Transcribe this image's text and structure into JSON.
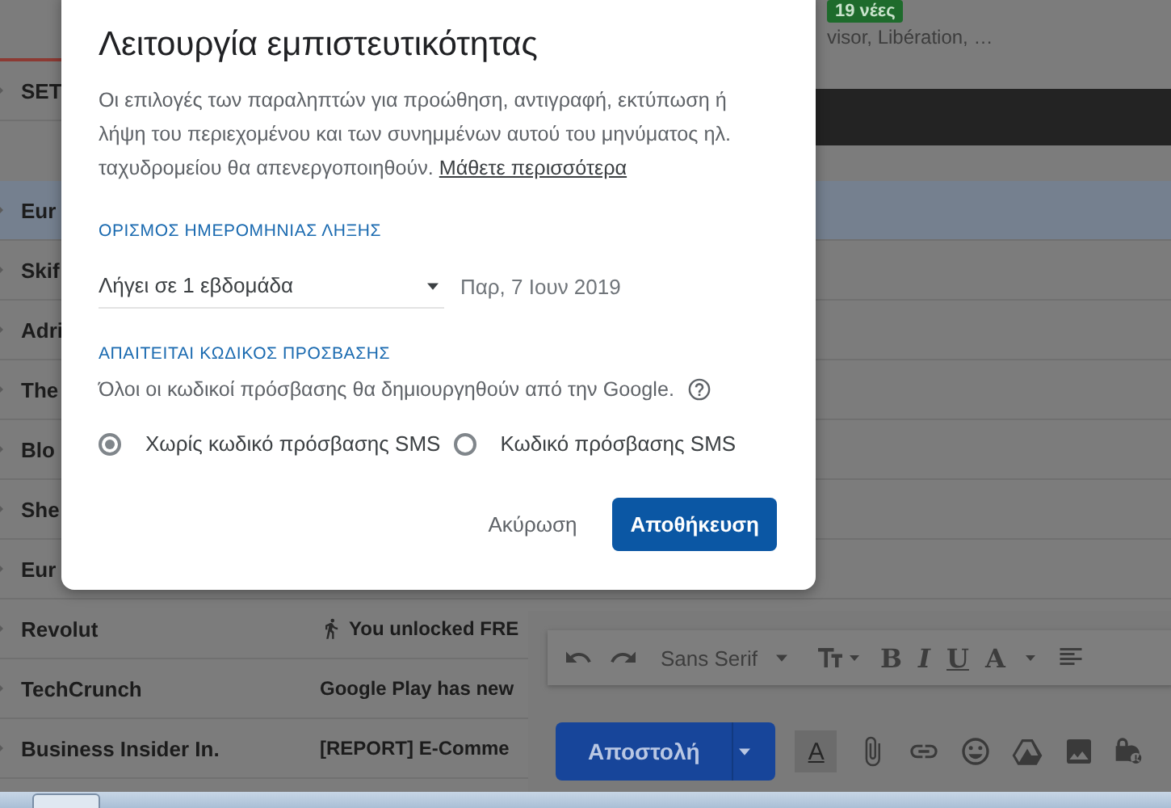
{
  "header": {
    "badge": "19 νέες",
    "snippet": "visor, Libération, …"
  },
  "emails": [
    {
      "sender": "SET",
      "selected": false
    },
    {
      "sender": "Eur",
      "selected": true
    },
    {
      "sender": "Skif",
      "selected": false
    },
    {
      "sender": "Adri",
      "selected": false
    },
    {
      "sender": "The",
      "selected": false
    },
    {
      "sender": "Blo",
      "selected": false
    },
    {
      "sender": "She",
      "selected": false
    },
    {
      "sender": "Eur",
      "selected": false
    },
    {
      "sender": "Revolut",
      "subject": "You unlocked FRE",
      "subject_icon": true,
      "selected": false
    },
    {
      "sender": "TechCrunch",
      "subject": "Google Play has new",
      "selected": false
    },
    {
      "sender": "Business Insider In.",
      "subject": "[REPORT] E-Comme",
      "selected": false
    }
  ],
  "compose": {
    "font": "Sans Serif",
    "format_glyphs": [
      "B",
      "I",
      "U",
      "A"
    ],
    "send": "Αποστολή",
    "text_color_glyph": "A"
  },
  "dialog": {
    "title": "Λειτουργία εμπιστευτικότητας",
    "description": "Οι επιλογές των παραληπτών για προώθηση, αντιγραφή, εκτύπωση ή λήψη του περιεχομένου και των συνημμένων αυτού του μηνύματος ηλ. ταχυδρομείου θα απενεργοποιηθούν.",
    "learn_more": "Μάθετε περισσότερα",
    "expiry_heading": "ΟΡΙΣΜΟΣ ΗΜΕΡΟΜΗΝΙΑΣ ΛΗΞΗΣ",
    "expiry_select": "Λήγει σε 1 εβδομάδα",
    "expiry_date": "Παρ, 7 Ιουν 2019",
    "passcode_heading": "ΑΠΑΙΤΕΙΤΑΙ ΚΩΔΙΚΟΣ ΠΡΟΣΒΑΣΗΣ",
    "passcode_note": "Όλοι οι κωδικοί πρόσβασης θα δημιουργηθούν από την Google.",
    "options": [
      {
        "label": "Χωρίς κωδικό πρόσβασης SMS",
        "selected": true
      },
      {
        "label": "Κωδικό πρόσβασης SMS",
        "selected": false
      }
    ],
    "cancel": "Ακύρωση",
    "save": "Αποθήκευση"
  }
}
